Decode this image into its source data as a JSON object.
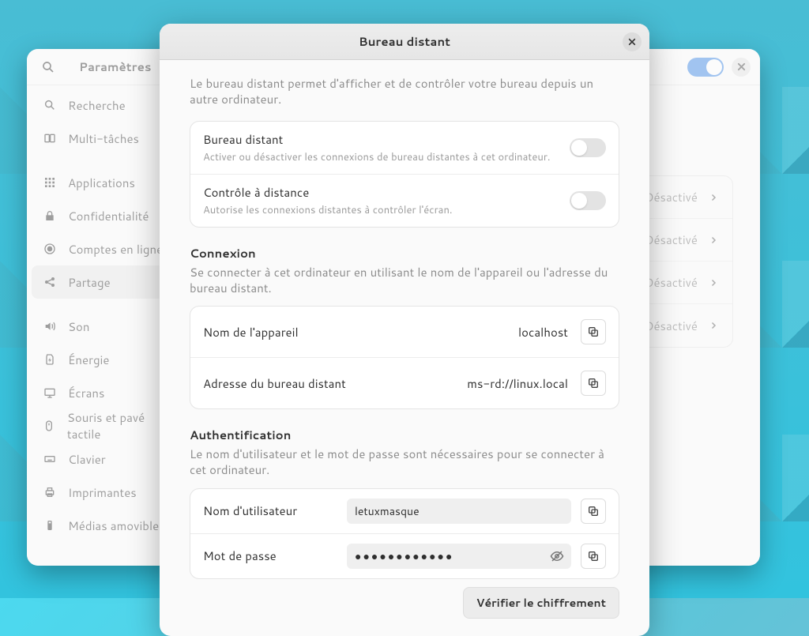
{
  "settings": {
    "title": "Paramètres",
    "sidebar": {
      "items": [
        {
          "label": "Recherche",
          "icon": "search"
        },
        {
          "label": "Multi-tâches",
          "icon": "multitask"
        },
        {
          "label": "Applications",
          "icon": "apps"
        },
        {
          "label": "Confidentialité",
          "icon": "privacy"
        },
        {
          "label": "Comptes en ligne",
          "icon": "accounts"
        },
        {
          "label": "Partage",
          "icon": "share"
        },
        {
          "label": "Son",
          "icon": "sound"
        },
        {
          "label": "Énergie",
          "icon": "energy"
        },
        {
          "label": "Écrans",
          "icon": "display"
        },
        {
          "label": "Souris et pavé tactile",
          "icon": "mouse"
        },
        {
          "label": "Clavier",
          "icon": "keyboard"
        },
        {
          "label": "Imprimantes",
          "icon": "printer"
        },
        {
          "label": "Médias amovibles",
          "icon": "removable"
        }
      ]
    },
    "content_rows": [
      {
        "status": "Désactivé"
      },
      {
        "status": "Désactivé"
      },
      {
        "status": "Désactivé"
      },
      {
        "status": "Désactivé"
      }
    ]
  },
  "modal": {
    "title": "Bureau distant",
    "intro": "Le bureau distant permet d'afficher et de contrôler votre bureau depuis un autre ordinateur.",
    "toggles": [
      {
        "title": "Bureau distant",
        "desc": "Activer ou désactiver les connexions de bureau distantes à cet ordinateur."
      },
      {
        "title": "Contrôle à distance",
        "desc": "Autorise les connexions distantes à contrôler l'écran."
      }
    ],
    "connexion": {
      "title": "Connexion",
      "desc": "Se connecter à cet ordinateur en utilisant le nom de l'appareil ou l'adresse du bureau distant.",
      "device_label": "Nom de l'appareil",
      "device_value": "localhost",
      "addr_label": "Adresse du bureau distant",
      "addr_value": "ms-rd://linux.local"
    },
    "auth": {
      "title": "Authentification",
      "desc": "Le nom d'utilisateur et le mot de passe sont nécessaires pour se connecter à cet ordinateur.",
      "user_label": "Nom d'utilisateur",
      "user_value": "letuxmasque",
      "pass_label": "Mot de passe",
      "pass_value": "●●●●●●●●●●●●"
    },
    "verify_label": "Vérifier le chiffrement"
  }
}
